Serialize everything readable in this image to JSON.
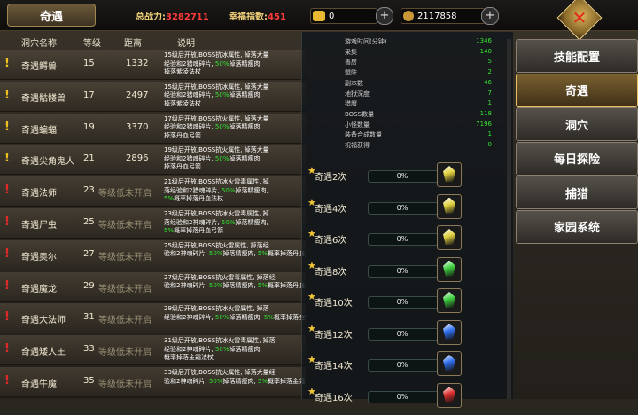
{
  "header": {
    "title": "奇遇",
    "power_label": "总战力:",
    "power_value": "3282711",
    "luck_label": "幸福指数:",
    "luck_value": "451",
    "gold_value": "0",
    "coin_value": "2117858"
  },
  "table": {
    "columns": [
      "洞穴名称",
      "等级",
      "距离",
      "说明"
    ],
    "rows": [
      {
        "alert": "yellow",
        "name": "奇遇鳄兽",
        "level": "15",
        "distance": "1332",
        "locked": "",
        "desc": [
          [
            "",
            "15级后开放,BOSS抗冰属性, 掉落大量"
          ],
          [
            "",
            "经验和2猎魂碎片, "
          ],
          [
            "g",
            "50%"
          ],
          [
            "",
            "掉落精瘦肉,"
          ],
          [
            "",
            "掉落紫凌法杖"
          ]
        ]
      },
      {
        "alert": "yellow",
        "name": "奇遇骷髅兽",
        "level": "17",
        "distance": "2497",
        "locked": "",
        "desc": [
          [
            "",
            "15级后开放,BOSS抗冰属性, 掉落大量"
          ],
          [
            "",
            "经验和2猎魂碎片, "
          ],
          [
            "g",
            "50%"
          ],
          [
            "",
            "掉落精瘦肉,"
          ],
          [
            "",
            "掉落紫凌法杖"
          ]
        ]
      },
      {
        "alert": "yellow",
        "name": "奇遇蝙蝠",
        "level": "19",
        "distance": "3370",
        "locked": "",
        "desc": [
          [
            "",
            "17级后开放,BOSS抗火属性, 掉落大量"
          ],
          [
            "",
            "经验和2猎魂碎片, "
          ],
          [
            "g",
            "50%"
          ],
          [
            "",
            "掉落精瘦肉,"
          ],
          [
            "",
            "掉落丹血弓箭"
          ]
        ]
      },
      {
        "alert": "yellow",
        "name": "奇遇尖角鬼人",
        "level": "21",
        "distance": "2896",
        "locked": "",
        "desc": [
          [
            "",
            "19级后开放,BOSS抗火属性, 掉落大量"
          ],
          [
            "",
            "经验和2猎魂碎片, "
          ],
          [
            "g",
            "50%"
          ],
          [
            "",
            "掉落精瘦肉,"
          ],
          [
            "",
            "掉落丹血弓箭"
          ]
        ]
      },
      {
        "alert": "red",
        "name": "奇遇法师",
        "level": "23",
        "distance": "",
        "locked": "等级低未开启",
        "desc": [
          [
            "",
            "21级后开放,BOSS抗冰火雷毒属性, 掉"
          ],
          [
            "",
            "落经验和2猎魂碎片, "
          ],
          [
            "g",
            "50%"
          ],
          [
            "",
            "掉落精瘦肉,"
          ],
          [
            "g",
            "5%"
          ],
          [
            "",
            "概率掉落丹血法杖"
          ]
        ]
      },
      {
        "alert": "red",
        "name": "奇遇尸虫",
        "level": "25",
        "distance": "",
        "locked": "等级低未开启",
        "desc": [
          [
            "",
            "23级后开放,BOSS抗冰火雷毒属性, 掉"
          ],
          [
            "",
            "落经验和2神魂碎片, "
          ],
          [
            "g",
            "50%"
          ],
          [
            "",
            "掉落精瘦肉,"
          ],
          [
            "g",
            "5%"
          ],
          [
            "",
            "概率掉落丹血弓箭"
          ]
        ]
      },
      {
        "alert": "red",
        "name": "奇遇奥尔",
        "level": "27",
        "distance": "",
        "locked": "等级低未开启",
        "desc": [
          [
            "",
            "25级后开放,BOSS抗火雷属性, 掉落经"
          ],
          [
            "",
            "验和2神魂碎片, "
          ],
          [
            "g",
            "50%"
          ],
          [
            "",
            "掉落精瘦肉, "
          ],
          [
            "g",
            "5%"
          ],
          [
            "",
            "概"
          ],
          [
            "",
            "率掉落丹血弓箭"
          ]
        ]
      },
      {
        "alert": "red",
        "name": "奇遇魔龙",
        "level": "29",
        "distance": "",
        "locked": "等级低未开启",
        "desc": [
          [
            "",
            "27级后开放,BOSS抗火雷毒属性, 掉落经"
          ],
          [
            "",
            "验和2神魂碎片, "
          ],
          [
            "g",
            "50%"
          ],
          [
            "",
            "掉落精瘦肉, "
          ],
          [
            "g",
            "5%"
          ],
          [
            "",
            "概"
          ],
          [
            "",
            "率掉落丹血弓箭"
          ]
        ]
      },
      {
        "alert": "red",
        "name": "奇遇大法师",
        "level": "31",
        "distance": "",
        "locked": "等级低未开启",
        "desc": [
          [
            "",
            "29级后开放,BOSS抗冰火雷属性, 掉落"
          ],
          [
            "",
            "经验和2神魂碎片, "
          ],
          [
            "g",
            "50%"
          ],
          [
            "",
            "掉落精瘦肉, "
          ],
          [
            "g",
            "5%"
          ],
          [
            "",
            "概率掉落金霜法杖"
          ]
        ]
      },
      {
        "alert": "red",
        "name": "奇遇矮人王",
        "level": "33",
        "distance": "",
        "locked": "等级低未开启",
        "desc": [
          [
            "",
            "31级后开放,BOSS抗冰火雷毒属性, 掉落"
          ],
          [
            "",
            "经验和2神魂碎片, "
          ],
          [
            "g",
            "50%"
          ],
          [
            "",
            "掉落精瘦肉,"
          ],
          [
            "",
            "概率掉落金霜法杖"
          ]
        ]
      },
      {
        "alert": "red",
        "name": "奇遇牛魔",
        "level": "35",
        "distance": "",
        "locked": "等级低未开启",
        "desc": [
          [
            "",
            "33级后开放,BOSS抗火属性, 掉落大量经"
          ],
          [
            "",
            "验和2神魂碎片, "
          ],
          [
            "g",
            "50%"
          ],
          [
            "",
            "掉落精瘦肉, "
          ],
          [
            "g",
            "5%"
          ],
          [
            "",
            "概率掉落金霜弓箭"
          ]
        ]
      }
    ]
  },
  "stats": [
    {
      "k": "游戏时间(分钟)",
      "v": "1346"
    },
    {
      "k": "采集",
      "v": "140"
    },
    {
      "k": "善房",
      "v": "5"
    },
    {
      "k": "盟阵",
      "v": "2"
    },
    {
      "k": "副本数",
      "v": "46"
    },
    {
      "k": "地狱深度",
      "v": "7"
    },
    {
      "k": "猎魔",
      "v": "1"
    },
    {
      "k": "BOSS数量",
      "v": "118"
    },
    {
      "k": "小怪数量",
      "v": "7196"
    },
    {
      "k": "装备合成数量",
      "v": "1"
    },
    {
      "k": "祝福获得",
      "v": "0"
    }
  ],
  "quests": [
    {
      "label": "奇遇2次",
      "pct": "0%",
      "progress": 0,
      "gem": "#e0d040"
    },
    {
      "label": "奇遇4次",
      "pct": "0%",
      "progress": 0,
      "gem": "#e0d040"
    },
    {
      "label": "奇遇6次",
      "pct": "0%",
      "progress": 0,
      "gem": "#e0d040"
    },
    {
      "label": "奇遇8次",
      "pct": "0%",
      "progress": 0,
      "gem": "#40d040"
    },
    {
      "label": "奇遇10次",
      "pct": "0%",
      "progress": 0,
      "gem": "#40d040"
    },
    {
      "label": "奇遇12次",
      "pct": "0%",
      "progress": 0,
      "gem": "#3070f0"
    },
    {
      "label": "奇遇14次",
      "pct": "0%",
      "progress": 0,
      "gem": "#3070f0"
    },
    {
      "label": "奇遇16次",
      "pct": "0%",
      "progress": 0,
      "gem": "#e03030"
    }
  ],
  "menu": [
    {
      "label": "技能配置",
      "active": false
    },
    {
      "label": "奇遇",
      "active": true
    },
    {
      "label": "洞穴",
      "active": false
    },
    {
      "label": "每日探险",
      "active": false
    },
    {
      "label": "捕猎",
      "active": false
    },
    {
      "label": "家园系统",
      "active": false
    }
  ],
  "colors": {
    "alert_yellow": "#f0c020",
    "alert_red": "#e02a2a",
    "accent": "#e8c060"
  }
}
